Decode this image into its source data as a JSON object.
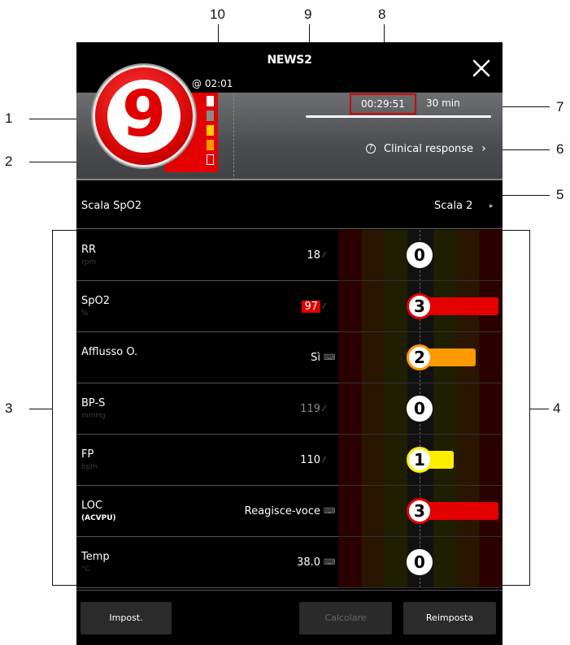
{
  "callouts": [
    "1",
    "2",
    "3",
    "4",
    "5",
    "6",
    "7",
    "8",
    "9",
    "10"
  ],
  "header": {
    "title": "NEWS2",
    "close_icon": "close-icon"
  },
  "score": {
    "value": "9",
    "timestamp": "@ 02:01",
    "level_colors": [
      "#ffffff",
      "#8a8a8a",
      "#ffd000",
      "#ff9900",
      "#e40000"
    ]
  },
  "timer": {
    "elapsed": "00:29:51",
    "interval": "30 min"
  },
  "clinical_response": {
    "label": "Clinical response",
    "icon": "help-icon"
  },
  "scale": {
    "label": "Scala SpO2",
    "value": "Scala 2"
  },
  "parameters": [
    {
      "name": "RR",
      "unit": "rpm",
      "value": "18",
      "icon": "edit-icon",
      "score": "0"
    },
    {
      "name": "SpO2",
      "unit": "%",
      "value": "97",
      "icon": "edit-icon",
      "score": "3"
    },
    {
      "name": "Afflusso O.",
      "unit": "",
      "value": "Sì",
      "icon": "keyboard-icon",
      "score": "2"
    },
    {
      "name": "BP-S",
      "unit": "mmHg",
      "value": "119",
      "icon": "edit-icon",
      "score": "0"
    },
    {
      "name": "FP",
      "unit": "bpm",
      "value": "110",
      "icon": "edit-icon",
      "score": "1"
    },
    {
      "name": "LOC",
      "unit": "(ACVPU)",
      "value": "Reagisce-voce",
      "icon": "keyboard-icon",
      "score": "3"
    },
    {
      "name": "Temp",
      "unit": "°C",
      "value": "38.0",
      "icon": "keyboard-icon",
      "score": "0"
    }
  ],
  "score_colors": {
    "0": "#ffffff",
    "1": "#ffee00",
    "2": "#ff9900",
    "3": "#e40000"
  },
  "footer": {
    "setup": "Impost.",
    "calculate": "Calcolare",
    "reset": "Reimposta"
  }
}
